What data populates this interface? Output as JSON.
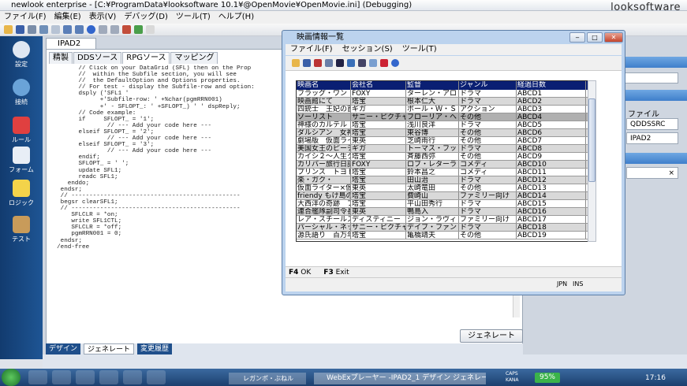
{
  "app": {
    "title": "newlook enterprise - [C:¥ProgramData¥looksoftware 10.1¥@OpenMovie¥OpenMovie.ini] (Debugging)",
    "brand": "looksoftware"
  },
  "menu": [
    "ファイル(F)",
    "編集(E)",
    "表示(V)",
    "デバッグ(D)",
    "ツール(T)",
    "ヘルプ(H)"
  ],
  "sidebar": [
    {
      "label": "設定",
      "icon": "gear-icon",
      "color": "#dfe7f2"
    },
    {
      "label": "接続",
      "icon": "globe-icon",
      "color": "#6aa3d8"
    },
    {
      "label": "ルール",
      "icon": "cube-icon",
      "color": "#e04040"
    },
    {
      "label": "フォーム",
      "icon": "form-icon",
      "color": "#e8eef6"
    },
    {
      "label": "ロジック",
      "icon": "lightning-icon",
      "color": "#f3d34a"
    },
    {
      "label": "テスト",
      "icon": "tools-icon",
      "color": "#c89b5a"
    }
  ],
  "doc_tab": "IPAD2",
  "subtabs": [
    "精製",
    "DDSソース",
    "RPGソース",
    "マッピング"
  ],
  "code_lines": [
    "        // Click on your DataGrid (SFL) then on the Prop",
    "        //  within the Subfile section, you will see",
    "        //  the DefaultOption and Options properties.",
    "",
    "        // For test - display the Subfile-row and option:",
    "        dsply ('SFL1 '",
    "              +'Subfile-row: ' +%char(pgmRRN001)",
    "              +' - SFLOPT_: ' +SFLOPT_) ' ' dspReply;",
    "",
    "        // Code example:",
    "        if     SFLOPT_ = '1';",
    "                // --- Add your code here ---",
    "        elseif SFLOPT_ = '2';",
    "                // --- Add your code here ---",
    "        elseif SFLOPT_ = '3';",
    "                // --- Add your code here ---",
    "        endif;",
    "",
    "        SFLOPT_ = ' ';",
    "        update SFL1;",
    "",
    "        readc SFL1;",
    "     enddo;",
    "   endsr;",
    "",
    "   // -----------------------------------------------",
    "   begsr clearSFL1;",
    "   // -----------------------------------------------",
    "      SFLCLR = *on;",
    "      write SFL1CTL;",
    "      SFLCLR = *off;",
    "      pgmRRN001 = 0;",
    "   endsr;",
    "",
    "  /end-free"
  ],
  "generate_button": "ジェネレート",
  "bottom_tabs": [
    "デザイン",
    "ジェネレート",
    "変更履歴"
  ],
  "right_panel": {
    "file_label": "ファイル",
    "field1": "QDDSSRC",
    "field2": "IPAD2",
    "close_glyph": "×"
  },
  "movie_window": {
    "title": "映画情報一覧",
    "menu": [
      "ファイル(F)",
      "セッション(S)",
      "ツール(T)"
    ],
    "columns": [
      "映画名",
      "会社名",
      "監督",
      "ジャンル",
      "経過日数"
    ],
    "rows": [
      [
        "フラッグ・ワン",
        "FOXY",
        "ターレン・アロ",
        "ドラマ",
        "ABCD1"
      ],
      [
        "映画館にて",
        "塔宝",
        "根本仁大",
        "ドラマ",
        "ABCD2"
      ],
      [
        "四銃士　王妃の首",
        "ギガ",
        "ポール・Ｗ・Ｓ・",
        "アクション",
        "ABCD3"
      ],
      [
        "ソーリスト",
        "サニー・ピクチャ",
        "フローリア・ヘ",
        "その他",
        "ABCD4"
      ],
      [
        "神様のカルテル",
        "塔宝",
        "浅川良洋",
        "ドラマ",
        "ABCD5"
      ],
      [
        "ダルシアン　女神",
        "塔宝",
        "東谷博",
        "その他",
        "ABCD6"
      ],
      [
        "劇場版　仮面ライ",
        "東英",
        "芝崎雨行",
        "その他",
        "ABCD7"
      ],
      [
        "美国女王のピーチ",
        "ギガ",
        "トーマス・フッ",
        "ドラマ",
        "ABCD8"
      ],
      [
        "カイシ２〜人生ク",
        "塔宝",
        "斉藤西弥",
        "その他",
        "ABCD9"
      ],
      [
        "カリバー旅行日記",
        "FOXY",
        "ロブ・レターラ",
        "コメディ",
        "ABCD10"
      ],
      [
        "プリンス　トヨト",
        "塔宝",
        "鈴本昌之",
        "コメディ",
        "ABCD11"
      ],
      [
        "楽・ガク・",
        "塔宝",
        "田山治",
        "ドラマ",
        "ABCD12"
      ],
      [
        "仮面ライター×仮",
        "東英",
        "太崎竜田",
        "その他",
        "ABCD13"
      ],
      [
        "friendy もけ島の",
        "塔宝",
        "費崎山",
        "ファミリー向け",
        "ABCD14"
      ],
      [
        "大西洋の奇跡　ブ",
        "塔宝",
        "平山田秀行",
        "ドラマ",
        "ABCD15"
      ],
      [
        "連合艦隊副司令長",
        "東英",
        "鴨島入",
        "ドラマ",
        "ABCD16"
      ],
      [
        "レア・スチールス",
        "ディスティニー",
        "ジョン・ラヴィ",
        "ファミリー向け",
        "ABCD17"
      ],
      [
        "パーシャル・ネッ",
        "サニー・ピクチャ",
        "デイブ・ファン",
        "ドラマ",
        "ABCD18"
      ],
      [
        "源氏語り　百万年",
        "塔宝",
        "亀橋靖夫",
        "その他",
        "ABCD19"
      ]
    ],
    "fkeys": [
      "OK",
      "Exit"
    ],
    "fkey_codes": [
      "F4",
      "F3"
    ],
    "status": {
      "jpn": "JPN",
      "ins": "INS"
    }
  },
  "taskbar": {
    "app1": "レガンポ・ぶねル",
    "app2": "WebExプレーヤー -IPAD2_1 デザイン ジェネレート 実行",
    "lang_top": "CAPS",
    "lang_bottom": "KANA",
    "battery": "95%",
    "clock": "17:16"
  },
  "colors": {
    "sidebar": "#1a4a86",
    "grid_header": "#0a1f73",
    "window_frame": "#bcd3ee",
    "accent": "#3f7fcb"
  }
}
